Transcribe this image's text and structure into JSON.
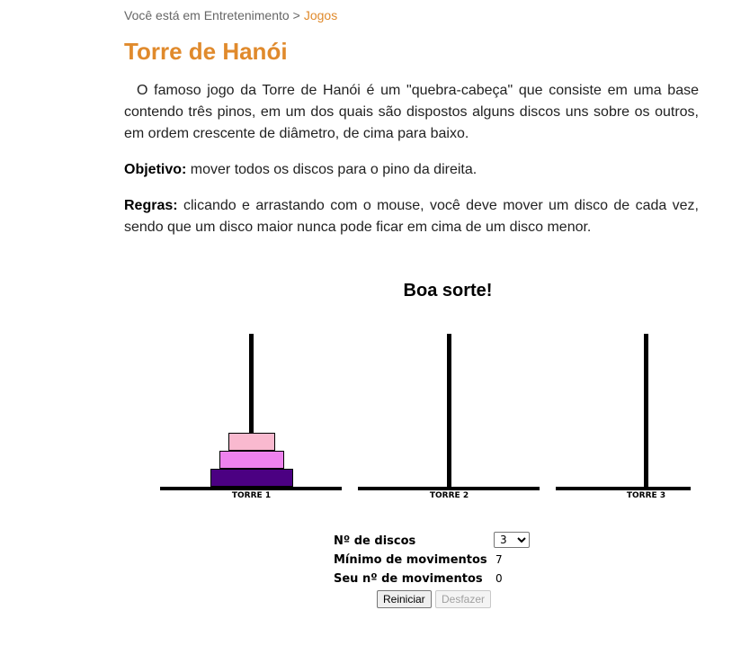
{
  "breadcrumb": {
    "prefix": "Você está em Entretenimento",
    "separator": ">",
    "current": "Jogos"
  },
  "page": {
    "title": "Torre de Hanói",
    "intro": "O famoso jogo da Torre de Hanói é um \"quebra-cabeça\" que consiste em uma base contendo três pinos, em um dos quais são dispostos alguns discos uns sobre os outros, em ordem crescente de diâmetro, de cima para baixo.",
    "objective_label": "Objetivo:",
    "objective_text": "mover todos os discos para o pino da direita.",
    "rules_label": "Regras:",
    "rules_text": "clicando e arrastando com o mouse, você deve mover um disco de cada vez, sendo que um disco maior nunca pode ficar em cima de um disco menor."
  },
  "game": {
    "title": "Boa sorte!",
    "towers": [
      {
        "label": "TORRE 1",
        "disks": [
          3,
          2,
          1
        ]
      },
      {
        "label": "TORRE 2",
        "disks": []
      },
      {
        "label": "TORRE 3",
        "disks": []
      }
    ],
    "disk_colors": {
      "1": "#f9b9cf",
      "2": "#ee82ee",
      "3": "#4b0082"
    }
  },
  "controls": {
    "num_disks_label": "Nº de discos",
    "num_disks_value": "3",
    "min_moves_label": "Mínimo de movimentos",
    "min_moves_value": "7",
    "your_moves_label": "Seu nº de movimentos",
    "your_moves_value": "0",
    "restart_label": "Reiniciar",
    "undo_label": "Desfazer"
  }
}
